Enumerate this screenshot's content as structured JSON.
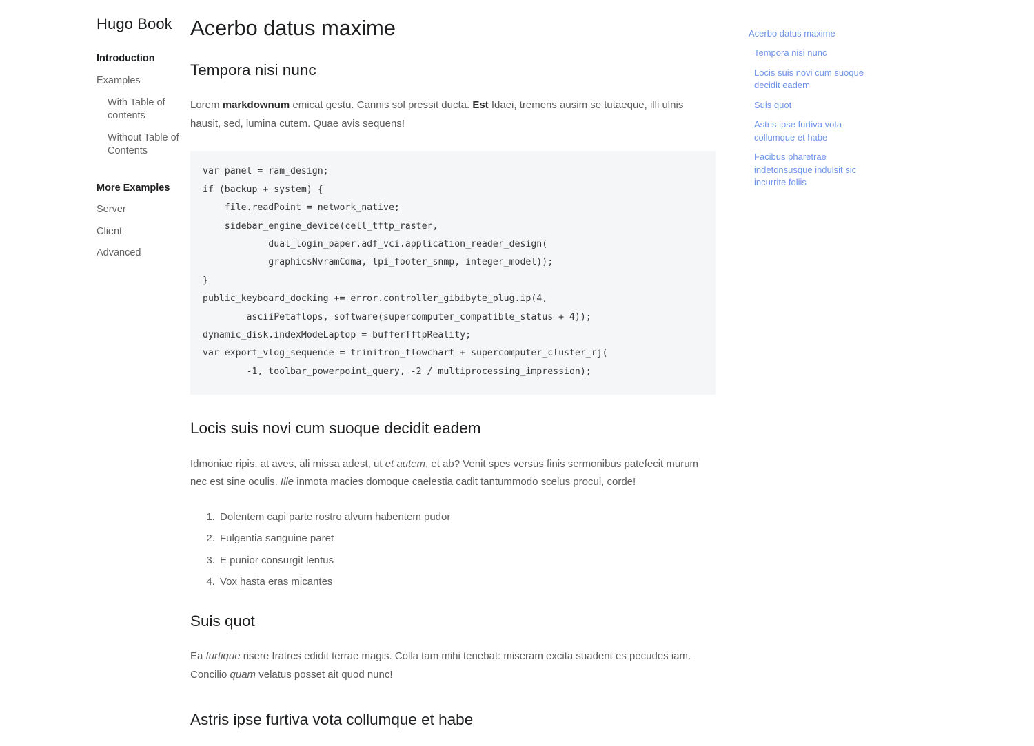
{
  "sidebar": {
    "brand": "Hugo Book",
    "items": [
      {
        "label": "Introduction",
        "level": 1,
        "active": true
      },
      {
        "label": "Examples",
        "level": 1,
        "active": false
      },
      {
        "label": "With Table of contents",
        "level": 2,
        "active": false
      },
      {
        "label": "Without Table of Contents",
        "level": 2,
        "active": false
      },
      {
        "label": "More Examples",
        "level": 1,
        "active": false,
        "bold": true,
        "gap_before": true
      },
      {
        "label": "Server",
        "level": 1,
        "active": false
      },
      {
        "label": "Client",
        "level": 1,
        "active": false
      },
      {
        "label": "Advanced",
        "level": 1,
        "active": false
      }
    ]
  },
  "main": {
    "title": "Acerbo datus maxime",
    "section_1": {
      "heading": "Tempora nisi nunc",
      "paragraph_pre": "Lorem ",
      "paragraph_bold_1": "markdownum",
      "paragraph_mid": " emicat gestu. Cannis sol pressit ducta. ",
      "paragraph_bold_2": "Est",
      "paragraph_post": " Idaei, tremens ausim se tutaeque, illi ulnis hausit, sed, lumina cutem. Quae avis sequens!",
      "code": "var panel = ram_design;\nif (backup + system) {\n    file.readPoint = network_native;\n    sidebar_engine_device(cell_tftp_raster,\n            dual_login_paper.adf_vci.application_reader_design(\n            graphicsNvramCdma, lpi_footer_snmp, integer_model));\n}\npublic_keyboard_docking += error.controller_gibibyte_plug.ip(4,\n        asciiPetaflops, software(supercomputer_compatible_status + 4));\ndynamic_disk.indexModeLaptop = bufferTftpReality;\nvar export_vlog_sequence = trinitron_flowchart + supercomputer_cluster_rj(\n        -1, toolbar_powerpoint_query, -2 / multiprocessing_impression);"
    },
    "section_2": {
      "heading": "Locis suis novi cum suoque decidit eadem",
      "paragraph_pre": "Idmoniae ripis, at aves, ali missa adest, ut ",
      "paragraph_italic_1": "et autem",
      "paragraph_mid": ", et ab? Venit spes versus finis sermonibus patefecit murum nec est sine oculis. ",
      "paragraph_italic_2": "Ille",
      "paragraph_post": " inmota macies domoque caelestia cadit tantummodo scelus procul, corde!",
      "list": [
        "Dolentem capi parte rostro alvum habentem pudor",
        "Fulgentia sanguine paret",
        "E punior consurgit lentus",
        "Vox hasta eras micantes"
      ]
    },
    "section_3": {
      "heading": "Suis quot",
      "paragraph_pre": "Ea ",
      "paragraph_italic_1": "furtique",
      "paragraph_mid": " risere fratres edidit terrae magis. Colla tam mihi tenebat: miseram excita suadent es pecudes iam. Concilio ",
      "paragraph_italic_2": "quam",
      "paragraph_post": " velatus posset ait quod nunc!"
    },
    "section_4": {
      "heading": "Astris ipse furtiva vota collumque et habe"
    }
  },
  "toc": {
    "items": [
      {
        "label": "Acerbo datus maxime",
        "level": 1
      },
      {
        "label": "Tempora nisi nunc",
        "level": 2
      },
      {
        "label": "Locis suis novi cum suoque decidit eadem",
        "level": 2
      },
      {
        "label": "Suis quot",
        "level": 2
      },
      {
        "label": "Astris ipse furtiva vota collumque et habe",
        "level": 2
      },
      {
        "label": "Facibus pharetrae indetonsusque indulsit sic incurrite foliis",
        "level": 2
      }
    ]
  },
  "colors": {
    "link": "#6f94ea",
    "text": "#5b5b5b",
    "heading": "#1d1f21",
    "code_bg": "#f5f6f8"
  }
}
